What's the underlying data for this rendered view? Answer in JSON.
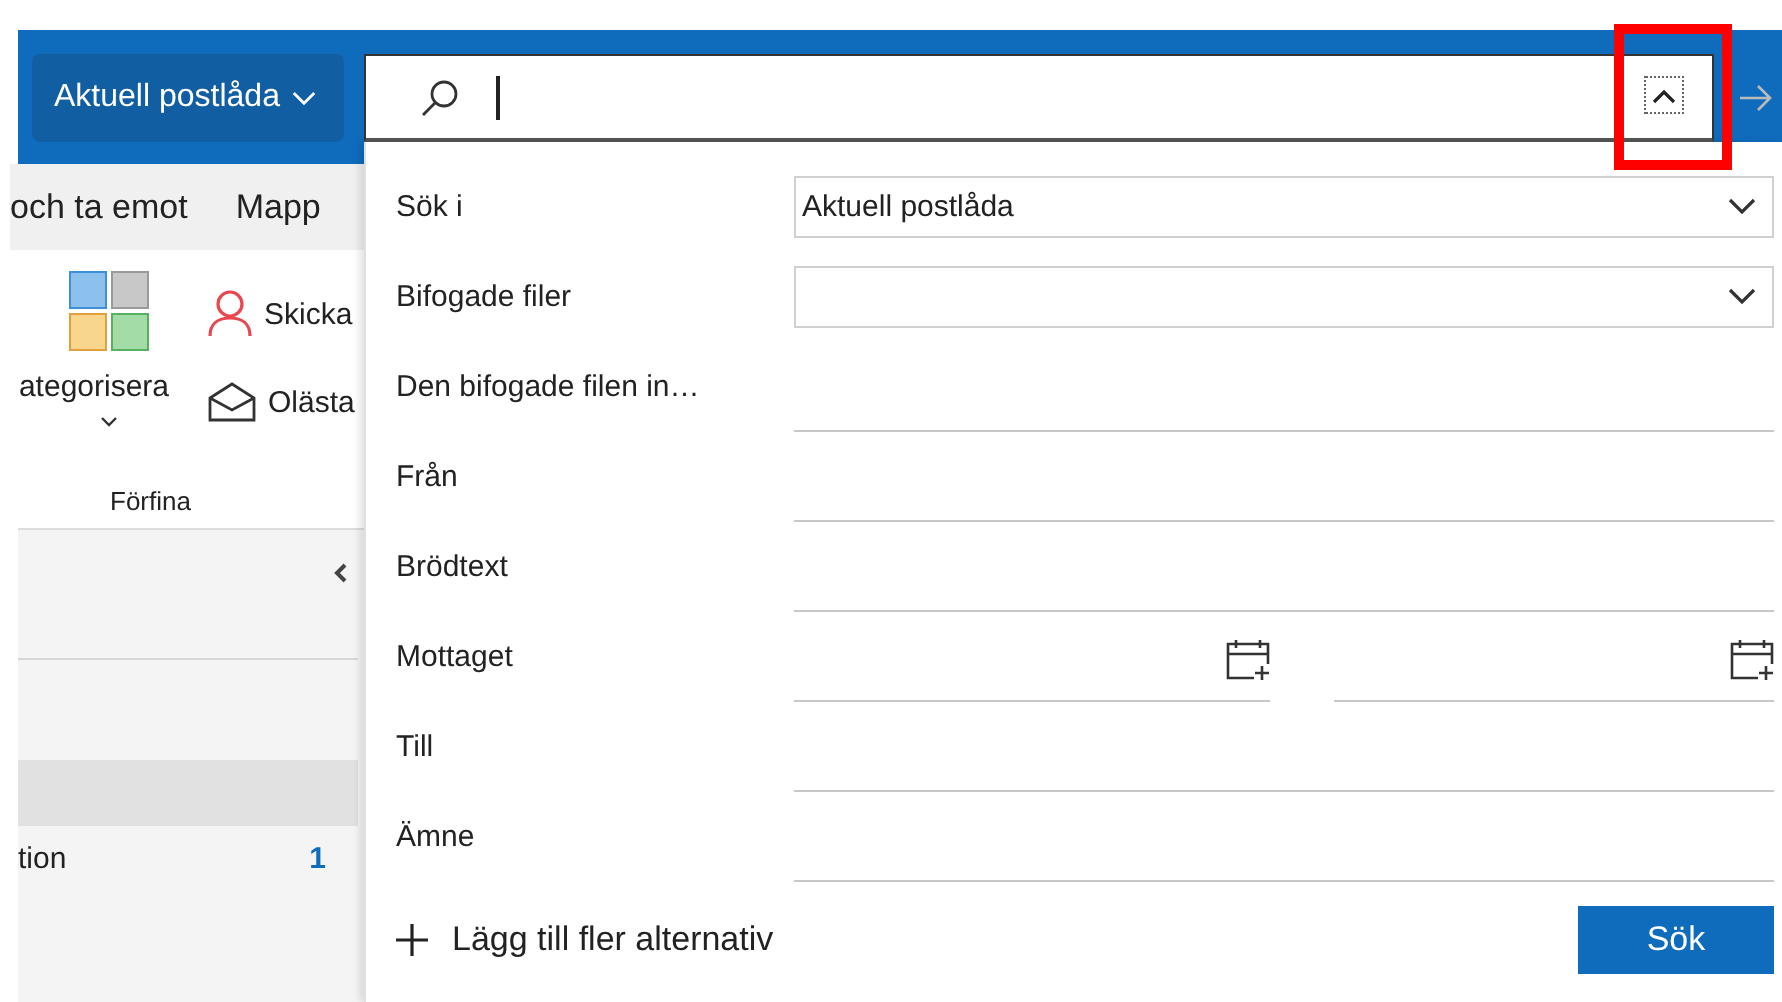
{
  "scope_button": {
    "label": "Aktuell postlåda"
  },
  "ribbon": {
    "tabs": [
      {
        "label": "och ta emot"
      },
      {
        "label": "Mapp"
      }
    ],
    "commands": [
      {
        "kind": "categorize",
        "label": "ategorisera"
      },
      {
        "kind": "person",
        "label": "Skicka"
      },
      {
        "kind": "envelope",
        "label": "Olästa"
      }
    ],
    "group_label": "Förfina"
  },
  "folders": [
    {
      "selected": true
    },
    {
      "label": "tion",
      "count": "1",
      "selected": false
    }
  ],
  "search_panel": {
    "fields": [
      {
        "kind": "dropdown",
        "label": "Sök i",
        "value": "Aktuell postlåda"
      },
      {
        "kind": "dropdown",
        "label": "Bifogade filer"
      },
      {
        "kind": "text",
        "label": "Den bifogade filen in…"
      },
      {
        "kind": "text",
        "label": "Från"
      },
      {
        "kind": "text",
        "label": "Brödtext"
      },
      {
        "kind": "date_range",
        "label": "Mottaget"
      },
      {
        "kind": "text",
        "label": "Till"
      },
      {
        "kind": "text",
        "label": "Ämne"
      }
    ],
    "add_more": {
      "label": "Lägg till fler alternativ"
    },
    "submit": {
      "label": "Sök"
    }
  }
}
